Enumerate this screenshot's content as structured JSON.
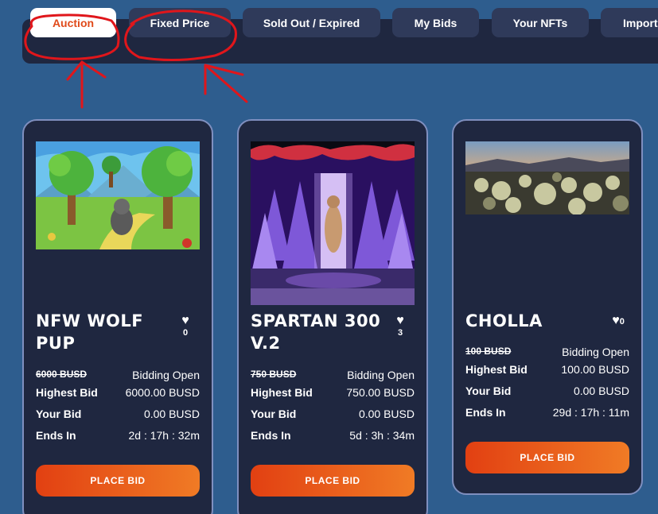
{
  "tabs": [
    {
      "label": "Auction",
      "active": true
    },
    {
      "label": "Fixed Price",
      "active": false
    },
    {
      "label": "Sold Out / Expired",
      "active": false
    },
    {
      "label": "My Bids",
      "active": false
    },
    {
      "label": "Your NFTs",
      "active": false
    },
    {
      "label": "Import",
      "active": false
    }
  ],
  "cards": [
    {
      "name_line1": "NFW WOLF",
      "name_line2": "PUP",
      "likes": "0",
      "price": "6000 BUSD",
      "status": "Bidding Open",
      "highest_bid_label": "Highest Bid",
      "highest_bid": "6000.00 BUSD",
      "your_bid_label": "Your Bid",
      "your_bid": "0.00 BUSD",
      "ends_label": "Ends In",
      "ends": "2d : 17h : 32m",
      "button": "PLACE BID"
    },
    {
      "name_line1": "SPARTAN 300",
      "name_line2": "V.2",
      "likes": "3",
      "price": "750 BUSD",
      "status": "Bidding Open",
      "highest_bid_label": "Highest Bid",
      "highest_bid": "750.00 BUSD",
      "your_bid_label": "Your Bid",
      "your_bid": "0.00 BUSD",
      "ends_label": "Ends In",
      "ends": "5d : 3h : 34m",
      "button": "PLACE BID"
    },
    {
      "name_line1": "CHOLLA",
      "likes": "0",
      "price": "100 BUSD",
      "status": "Bidding Open",
      "highest_bid_label": "Highest Bid",
      "highest_bid": "100.00 BUSD",
      "your_bid_label": "Your Bid",
      "your_bid": "0.00 BUSD",
      "ends_label": "Ends In",
      "ends": "29d : 17h : 11m",
      "button": "PLACE BID"
    }
  ],
  "colors": {
    "background": "#2e5d8e",
    "card": "#1f2740",
    "accent": "#e04a1a",
    "annotation": "#e0161b"
  }
}
